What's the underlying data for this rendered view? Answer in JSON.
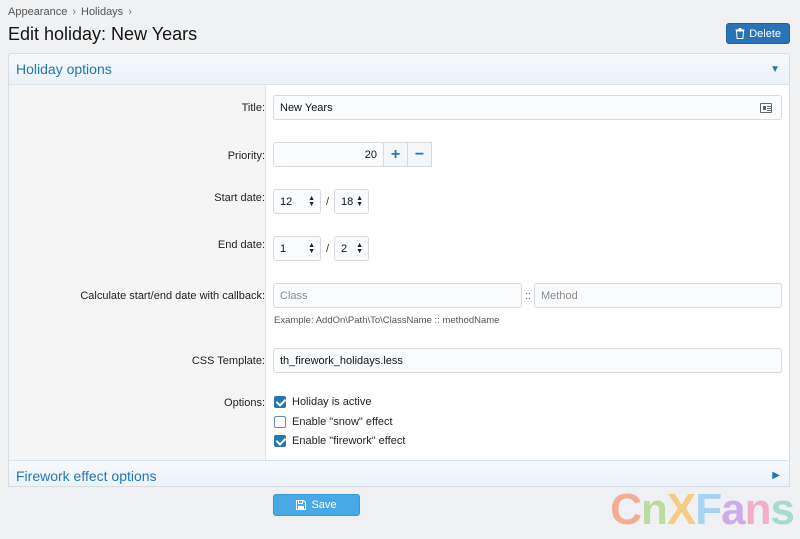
{
  "breadcrumb": {
    "items": [
      "Appearance",
      "Holidays"
    ],
    "separator": "›"
  },
  "page": {
    "title": "Edit holiday: New Years"
  },
  "toolbar": {
    "delete_label": "Delete"
  },
  "sections": {
    "holiday_options": "Holiday options",
    "firework_options": "Firework effect options"
  },
  "form": {
    "title": {
      "label": "Title:",
      "value": "New Years"
    },
    "priority": {
      "label": "Priority:",
      "value": "20",
      "plus": "+",
      "minus": "−"
    },
    "start_date": {
      "label": "Start date:",
      "month": "12",
      "day": "18",
      "separator": "/"
    },
    "end_date": {
      "label": "End date:",
      "month": "1",
      "day": "2",
      "separator": "/"
    },
    "callback": {
      "label": "Calculate start/end date with callback:",
      "class_placeholder": "Class",
      "method_placeholder": "Method",
      "separator": "::",
      "hint": "Example: AddOn\\Path\\To\\ClassName :: methodName"
    },
    "css_template": {
      "label": "CSS Template:",
      "value": "th_firework_holidays.less"
    },
    "options": {
      "label": "Options:",
      "items": [
        {
          "label": "Holiday is active",
          "checked": true
        },
        {
          "label": "Enable \"snow\" effect",
          "checked": false
        },
        {
          "label": "Enable \"firework\" effect",
          "checked": true
        }
      ]
    }
  },
  "actions": {
    "save_label": "Save"
  },
  "watermark": {
    "letters": [
      "C",
      "n",
      "X",
      "F",
      "a",
      "n",
      "s"
    ]
  },
  "colors": {
    "accent": "#2577b1",
    "delete_button": "#2b73b7",
    "save_button": "#48a9e6"
  }
}
